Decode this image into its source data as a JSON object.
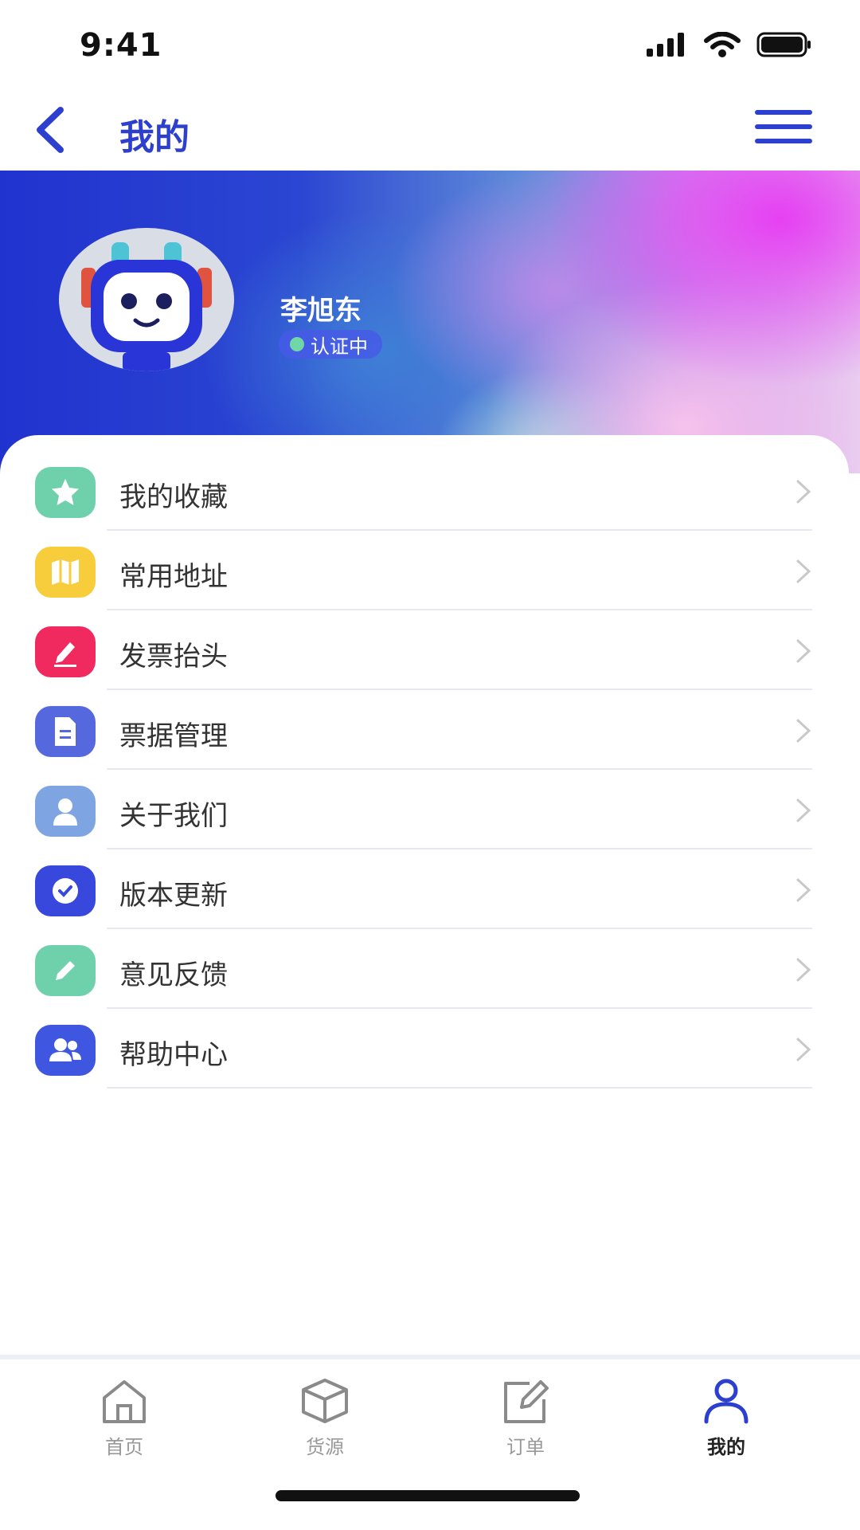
{
  "status_bar": {
    "time": "9:41"
  },
  "nav": {
    "title": "我的"
  },
  "profile": {
    "name": "李旭东",
    "status": "认证中"
  },
  "menu": [
    {
      "label": "我的收藏",
      "icon": "star-icon",
      "color": "#6fd0ac"
    },
    {
      "label": "常用地址",
      "icon": "map-icon",
      "color": "#f7cd3b"
    },
    {
      "label": "发票抬头",
      "icon": "pen-icon",
      "color": "#f02a5e"
    },
    {
      "label": "票据管理",
      "icon": "document-icon",
      "color": "#5568dd"
    },
    {
      "label": "关于我们",
      "icon": "user-icon",
      "color": "#7ea5e2"
    },
    {
      "label": "版本更新",
      "icon": "check-circle-icon",
      "color": "#3847dc"
    },
    {
      "label": "意见反馈",
      "icon": "pencil-icon",
      "color": "#6fd0ac"
    },
    {
      "label": "帮助中心",
      "icon": "users-icon",
      "color": "#3f56e0"
    }
  ],
  "tabs": [
    {
      "label": "首页",
      "icon": "home-icon",
      "active": false
    },
    {
      "label": "货源",
      "icon": "box-icon",
      "active": false
    },
    {
      "label": "订单",
      "icon": "edit-icon",
      "active": false
    },
    {
      "label": "我的",
      "icon": "profile-icon",
      "active": true
    }
  ],
  "colors": {
    "accent": "#2d3fcf",
    "tab_active": "#2d3fcf",
    "tab_inactive": "#8a8a8a"
  }
}
